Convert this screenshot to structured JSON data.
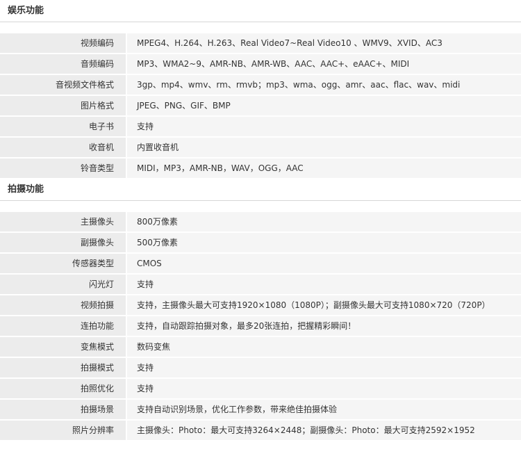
{
  "entertainment": {
    "title": "娱乐功能",
    "rows": [
      {
        "label": "视频编码",
        "value": "MPEG4、H.264、H.263、Real Video7~Real Video10 、WMV9、XVID、AC3"
      },
      {
        "label": "音频编码",
        "value": "MP3、WMA2~9、AMR-NB、AMR-WB、AAC、AAC+、eAAC+、MIDI"
      },
      {
        "label": "音视频文件格式",
        "value": "3gp、mp4、wmv、rm、rmvb；mp3、wma、ogg、amr、aac、flac、wav、midi"
      },
      {
        "label": "图片格式",
        "value": "JPEG、PNG、GIF、BMP"
      },
      {
        "label": "电子书",
        "value": "支持"
      },
      {
        "label": "收音机",
        "value": "内置收音机"
      },
      {
        "label": "铃音类型",
        "value": "MIDI，MP3，AMR-NB，WAV，OGG，AAC"
      }
    ]
  },
  "camera": {
    "title": "拍摄功能",
    "rows": [
      {
        "label": "主摄像头",
        "value": "800万像素"
      },
      {
        "label": "副摄像头",
        "value": "500万像素"
      },
      {
        "label": "传感器类型",
        "value": "CMOS"
      },
      {
        "label": "闪光灯",
        "value": "支持"
      },
      {
        "label": "视频拍摄",
        "value": "支持，主摄像头最大可支持1920×1080（1080P）；副摄像头最大可支持1080×720（720P）"
      },
      {
        "label": "连拍功能",
        "value": "支持，自动跟踪拍摄对象，最多20张连拍，把握精彩瞬间！"
      },
      {
        "label": "变焦模式",
        "value": "数码变焦"
      },
      {
        "label": "拍摄模式",
        "value": "支持"
      },
      {
        "label": "拍照优化",
        "value": "支持"
      },
      {
        "label": "拍摄场景",
        "value": "支持自动识别场景，优化工作参数，带来绝佳拍摄体验"
      },
      {
        "label": "照片分辨率",
        "value": "主摄像头：Photo：最大可支持3264×2448；副摄像头：Photo：最大可支持2592×1952"
      }
    ]
  }
}
